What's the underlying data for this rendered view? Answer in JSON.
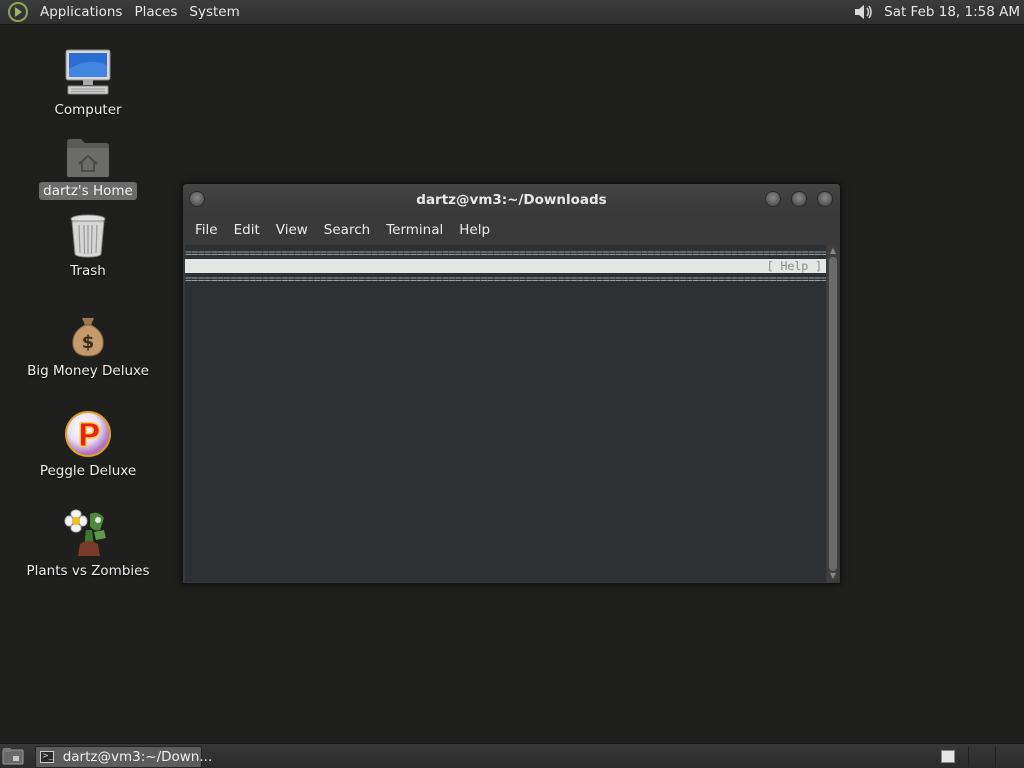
{
  "top_panel": {
    "menus": [
      "Applications",
      "Places",
      "System"
    ],
    "clock": "Sat Feb 18,  1:58 AM",
    "icons": [
      "distro-logo-icon",
      "volume-icon"
    ]
  },
  "desktop": {
    "icons": [
      {
        "label": "Computer",
        "icon": "computer-icon",
        "selected": false
      },
      {
        "label": "dartz's Home",
        "icon": "home-folder-icon",
        "selected": true
      },
      {
        "label": "Trash",
        "icon": "trash-icon",
        "selected": false
      },
      {
        "label": "Big Money Deluxe",
        "icon": "money-bag-icon",
        "selected": false
      },
      {
        "label": "Peggle Deluxe",
        "icon": "peggle-icon",
        "selected": false
      },
      {
        "label": "Plants vs Zombies",
        "icon": "plants-vs-zombies-icon",
        "selected": false
      }
    ]
  },
  "terminal": {
    "title": "dartz@vm3:~/Downloads",
    "menus": [
      "File",
      "Edit",
      "View",
      "Search",
      "Terminal",
      "Help"
    ],
    "rule_text": "==========================================================================================================",
    "status_bar_text": "[ Help ]"
  },
  "taskbar": {
    "task_label": "dartz@vm3:~/Down..."
  },
  "colors": {
    "desktop_bg": "#1f1f1e",
    "panel_bg": "#333333",
    "terminal_bg": "#2d3133",
    "selection": "#6b6b6b"
  }
}
